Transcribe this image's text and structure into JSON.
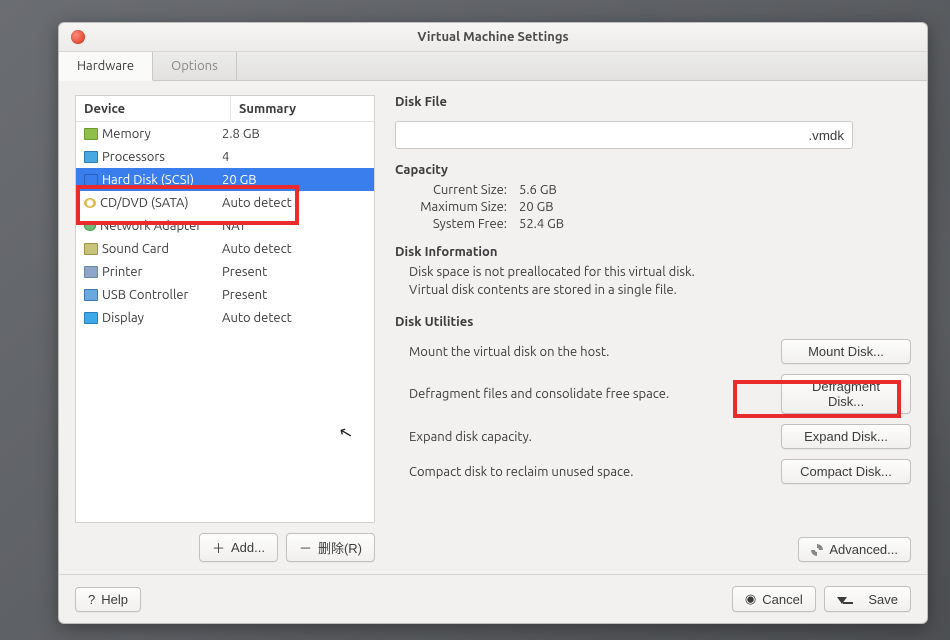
{
  "window": {
    "title": "Virtual Machine Settings"
  },
  "tabs": {
    "hardware": "Hardware",
    "options": "Options"
  },
  "device_headers": {
    "device": "Device",
    "summary": "Summary"
  },
  "devices": [
    {
      "name": "Memory",
      "summary": "2.8 GB",
      "icon": "ic-mem"
    },
    {
      "name": "Processors",
      "summary": "4",
      "icon": "ic-cpu"
    },
    {
      "name": "Hard Disk (SCSI)",
      "summary": "20 GB",
      "icon": "ic-disk",
      "selected": true
    },
    {
      "name": "CD/DVD (SATA)",
      "summary": "Auto detect",
      "icon": "ic-cd"
    },
    {
      "name": "Network Adapter",
      "summary": "NAT",
      "icon": "ic-net"
    },
    {
      "name": "Sound Card",
      "summary": "Auto detect",
      "icon": "ic-snd"
    },
    {
      "name": "Printer",
      "summary": "Present",
      "icon": "ic-prn"
    },
    {
      "name": "USB Controller",
      "summary": "Present",
      "icon": "ic-usb"
    },
    {
      "name": "Display",
      "summary": "Auto detect",
      "icon": "ic-disp"
    }
  ],
  "left_buttons": {
    "add": "Add...",
    "remove": "删除(R)"
  },
  "disk_file": {
    "label": "Disk File",
    "value": ".vmdk"
  },
  "capacity": {
    "label": "Capacity",
    "current_k": "Current Size:",
    "current_v": "5.6 GB",
    "max_k": "Maximum Size:",
    "max_v": "20 GB",
    "free_k": "System Free:",
    "free_v": "52.4 GB"
  },
  "disk_info": {
    "label": "Disk Information",
    "line1": "Disk space is not preallocated for this virtual disk.",
    "line2": "Virtual disk contents are stored in a single file."
  },
  "disk_util": {
    "label": "Disk Utilities",
    "mount_desc": "Mount the virtual disk on the host.",
    "mount_btn": "Mount Disk...",
    "defrag_desc": "Defragment files and consolidate free space.",
    "defrag_btn": "Defragment Disk...",
    "expand_desc": "Expand disk capacity.",
    "expand_btn": "Expand Disk...",
    "compact_desc": "Compact disk to reclaim unused space.",
    "compact_btn": "Compact Disk..."
  },
  "advanced_btn": "Advanced...",
  "footer": {
    "help": "Help",
    "cancel": "Cancel",
    "save": "Save"
  }
}
